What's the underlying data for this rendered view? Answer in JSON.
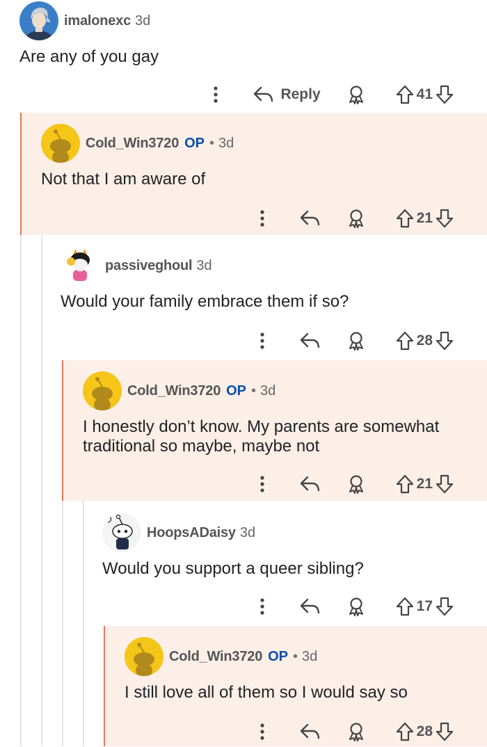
{
  "comments": [
    {
      "user": "imalonexc",
      "is_op": false,
      "op_label": "",
      "sep": "",
      "age": "3d",
      "text": "Are any of you gay",
      "reply_label": "Reply",
      "votes": "41"
    },
    {
      "user": "Cold_Win3720",
      "is_op": true,
      "op_label": "OP",
      "sep": "•",
      "age": "3d",
      "text": "Not that I am aware of",
      "reply_label": "",
      "votes": "21"
    },
    {
      "user": "passiveghoul",
      "is_op": false,
      "op_label": "",
      "sep": "",
      "age": "3d",
      "text": "Would your family embrace them if so?",
      "reply_label": "",
      "votes": "28"
    },
    {
      "user": "Cold_Win3720",
      "is_op": true,
      "op_label": "OP",
      "sep": "•",
      "age": "3d",
      "text": "I honestly don’t know. My parents are somewhat traditional so maybe, maybe not",
      "reply_label": "",
      "votes": "21"
    },
    {
      "user": "HoopsADaisy",
      "is_op": false,
      "op_label": "",
      "sep": "",
      "age": "3d",
      "text": "Would you support a queer sibling?",
      "reply_label": "",
      "votes": "17"
    },
    {
      "user": "Cold_Win3720",
      "is_op": true,
      "op_label": "OP",
      "sep": "•",
      "age": "3d",
      "text": "I still love all of them so I would say so",
      "reply_label": "",
      "votes": "28"
    }
  ],
  "colors": {
    "op_bg": "#fbefe8",
    "op_border": "#e8775a",
    "op_badge": "#0a4eb0"
  },
  "icons": [
    "more-vertical-icon",
    "reply-arrow-icon",
    "award-icon",
    "upvote-arrow-icon",
    "downvote-arrow-icon"
  ]
}
